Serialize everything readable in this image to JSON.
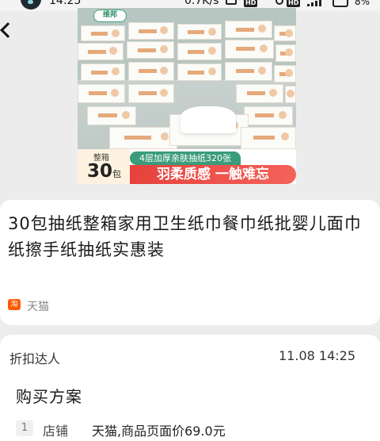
{
  "status_bar": {
    "time": "14:25",
    "network_speed": "0.7K/s",
    "hd1": "HD",
    "hd2": "HD",
    "battery": "8%"
  },
  "product_image": {
    "brand": "维邦",
    "tagline": "4层加厚亲肤抽纸320张",
    "slogan": "羽柔质感 一触难忘",
    "badge_top": "整箱",
    "badge_number": "30",
    "badge_unit": "包"
  },
  "product": {
    "title": "30包抽纸整箱家用卫生纸巾餐巾纸批婴儿面巾纸擦手纸抽纸实惠装",
    "shop_icon": "淘",
    "shop": "天猫"
  },
  "info": {
    "author": "折扣达人",
    "time": "11.08 14:25",
    "section_title": "购买方案",
    "plan": {
      "num": "1",
      "label": "店铺",
      "value": "天猫,商品页面价69.0元"
    }
  }
}
